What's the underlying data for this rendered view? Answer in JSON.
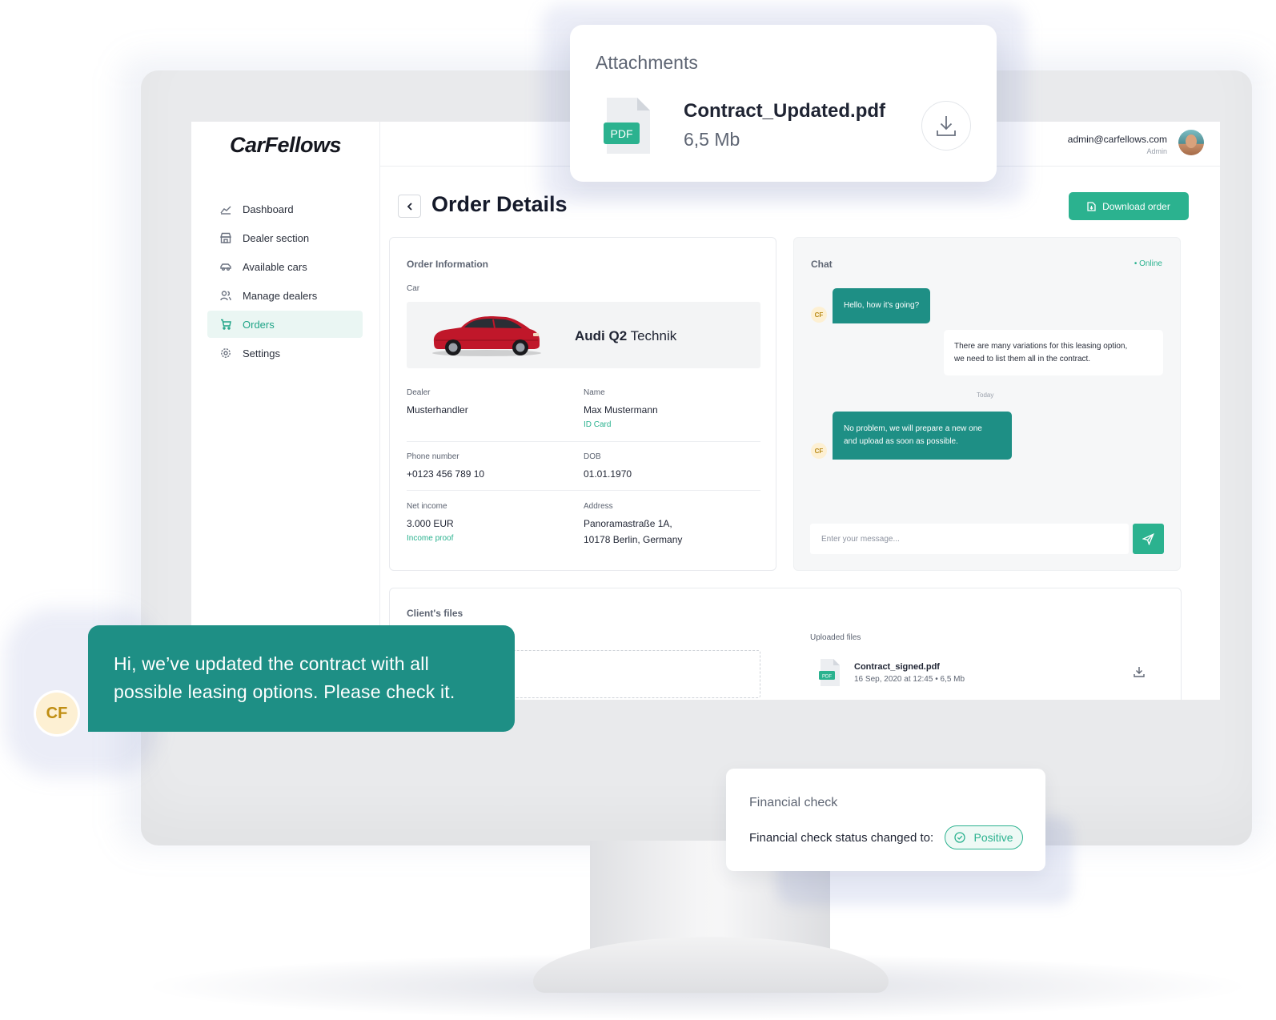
{
  "app": {
    "logo": "CarFellows",
    "accent_color": "#2bb28f",
    "chat_bubble_color": "#1e8f85"
  },
  "sidebar": {
    "items": [
      {
        "label": "Dashboard",
        "icon": "chart-line-icon",
        "active": false
      },
      {
        "label": "Dealer section",
        "icon": "store-icon",
        "active": false
      },
      {
        "label": "Available cars",
        "icon": "car-icon",
        "active": false
      },
      {
        "label": "Manage dealers",
        "icon": "users-icon",
        "active": false
      },
      {
        "label": "Orders",
        "icon": "cart-icon",
        "active": true
      },
      {
        "label": "Settings",
        "icon": "gear-icon",
        "active": false
      }
    ]
  },
  "topbar": {
    "email": "admin@carfellows.com",
    "role": "Admin"
  },
  "page": {
    "title": "Order Details",
    "download_button": "Download order"
  },
  "order": {
    "section_title": "Order Information",
    "car_label": "Car",
    "car_brand": "Audi Q2",
    "car_model": "Technik",
    "fields": {
      "dealer_label": "Dealer",
      "dealer_value": "Musterhandler",
      "name_label": "Name",
      "name_value": "Max Mustermann",
      "name_link": "ID Card",
      "phone_label": "Phone number",
      "phone_value": "+0123 456 789 10",
      "dob_label": "DOB",
      "dob_value": "01.01.1970",
      "income_label": "Net income",
      "income_value": "3.000 EUR",
      "income_link": "Income proof",
      "address_label": "Address",
      "address_line1": "Panoramastraße 1A,",
      "address_line2": "10178 Berlin, Germany"
    }
  },
  "chat": {
    "title": "Chat",
    "status": "• Online",
    "avatar_initials": "CF",
    "messages": [
      {
        "from": "cf",
        "text": "Hello, how it's going?"
      },
      {
        "from": "client",
        "line1": "There are many variations for this leasing option,",
        "line2": "we need to list them all in the contract."
      },
      {
        "from": "cf",
        "line1": "No problem, we will prepare a new one",
        "line2": "and upload as soon as possible."
      }
    ],
    "day_separator": "Today",
    "input_placeholder": "Enter your message..."
  },
  "files": {
    "section_title": "Client's files",
    "uploaded_label": "Uploaded files",
    "items": [
      {
        "name": "Contract_signed.pdf",
        "meta": "16 Sep, 2020 at 12:45 • 6,5 Mb",
        "type": "PDF"
      }
    ]
  },
  "attachments_popup": {
    "title": "Attachments",
    "file_name": "Contract_Updated.pdf",
    "file_size": "6,5 Mb",
    "file_type": "PDF"
  },
  "message_popup": {
    "line1": "Hi, we’ve updated the contract with all",
    "line2": "possible leasing options. Please check it.",
    "avatar_initials": "CF"
  },
  "financial_popup": {
    "title": "Financial check",
    "text": "Financial check status changed to:",
    "badge": "Positive"
  }
}
